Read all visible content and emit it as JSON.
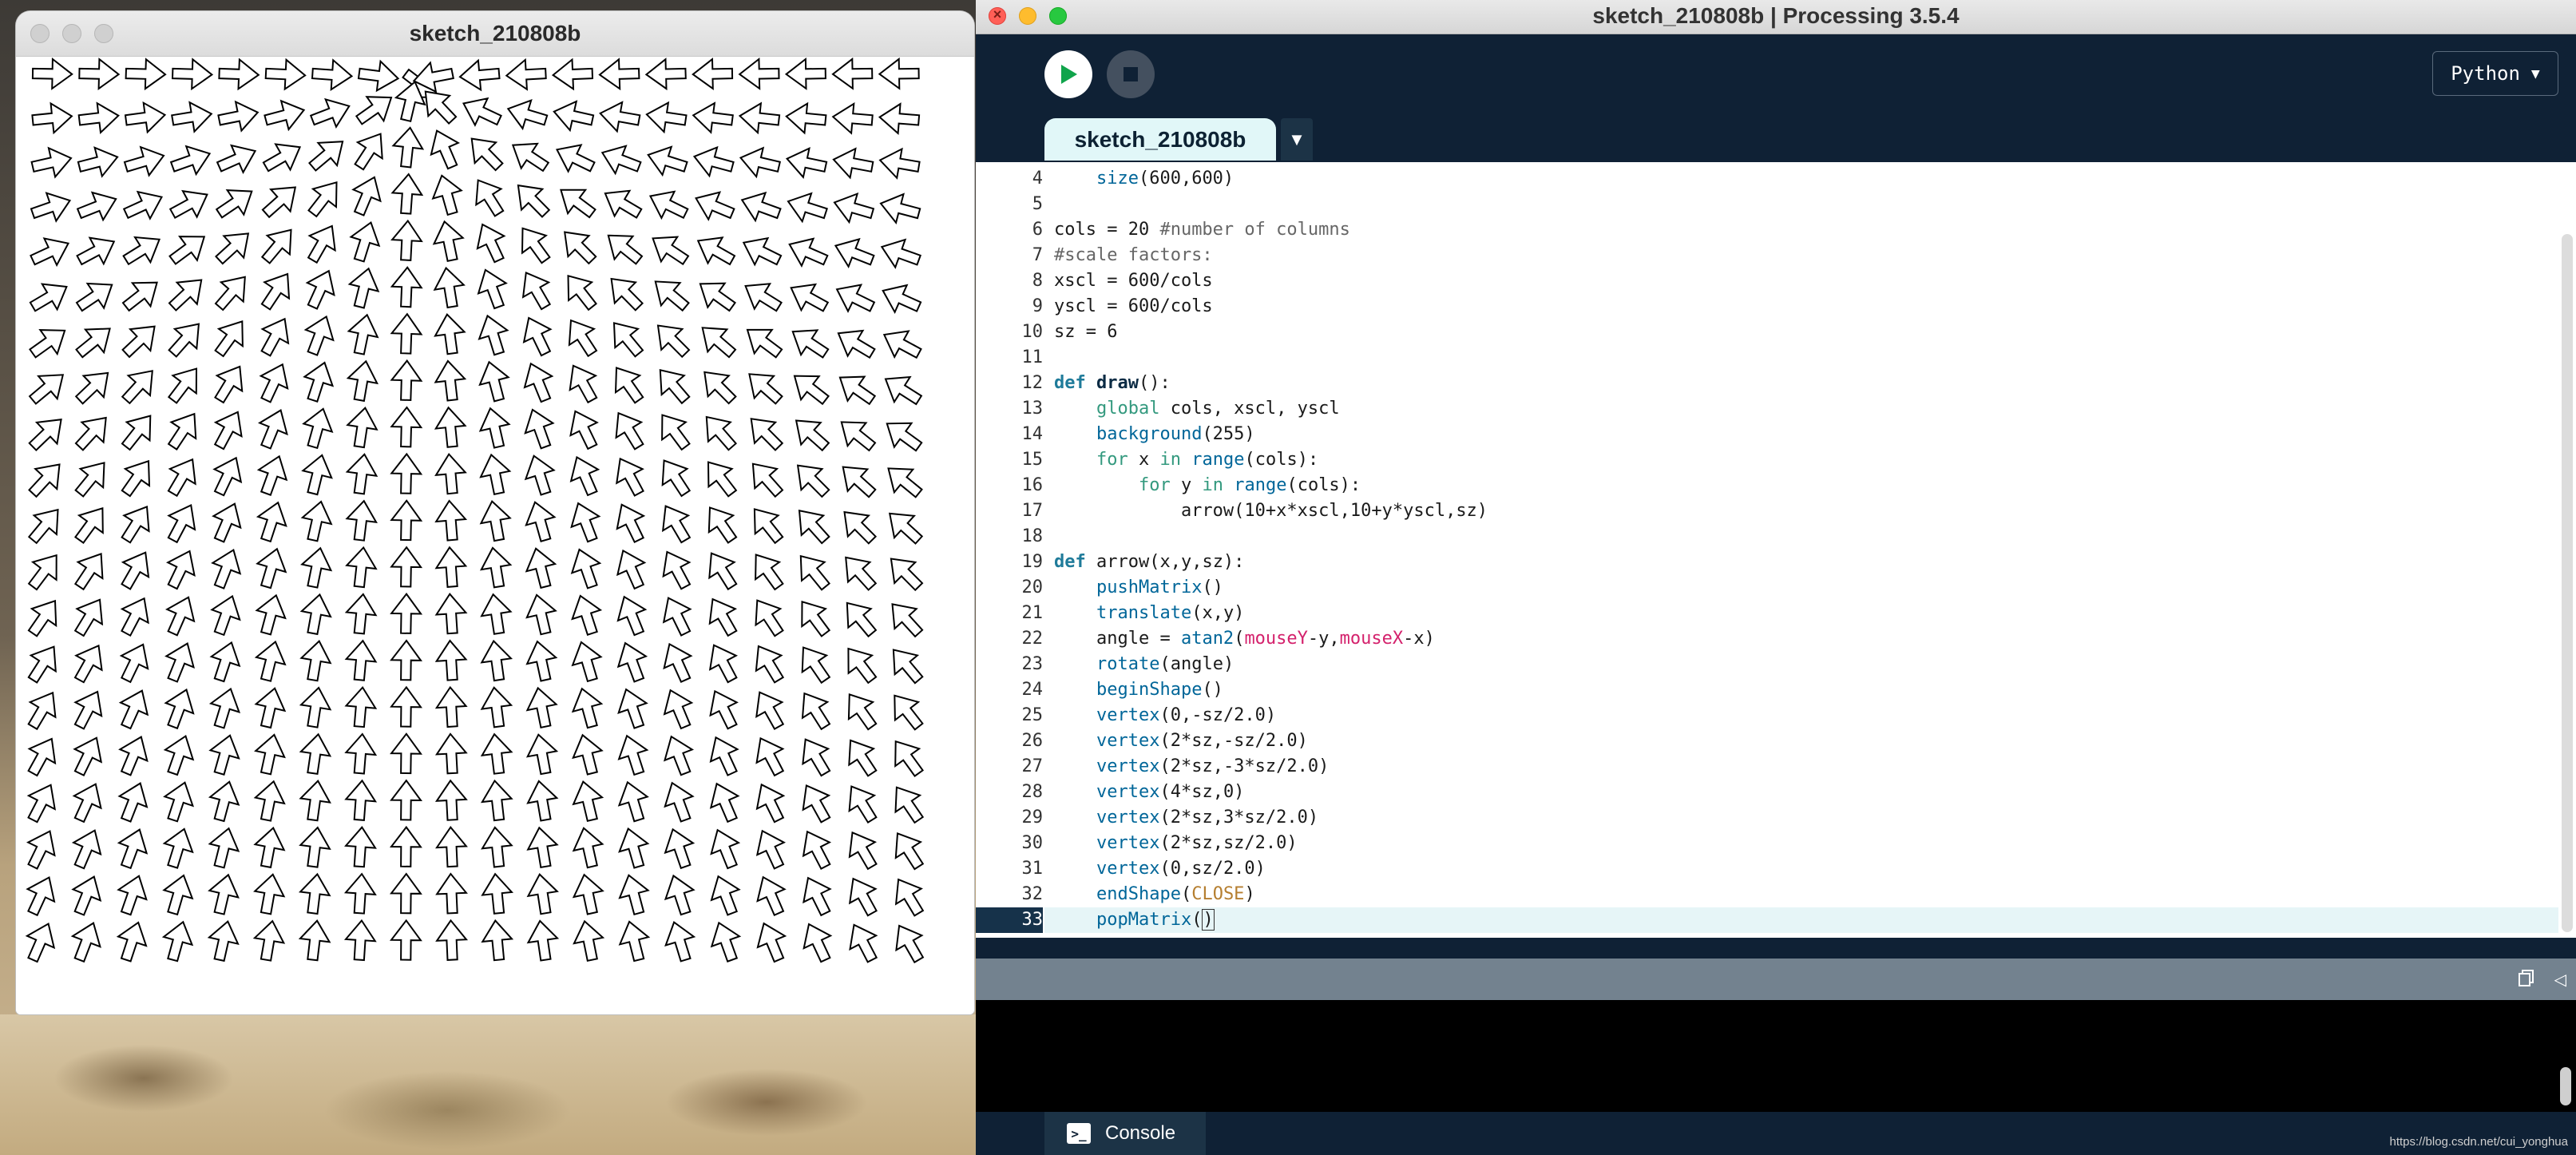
{
  "sketch_window": {
    "title": "sketch_210808b",
    "canvas": {
      "cols": 20,
      "rows": 20,
      "mouse_hint": "mouse near top center of canvas"
    }
  },
  "ide": {
    "window_title": "sketch_210808b | Processing 3.5.4",
    "toolbar": {
      "run_icon": "play-icon",
      "stop_icon": "stop-icon",
      "mode_label": "Python"
    },
    "tab": {
      "label": "sketch_210808b"
    },
    "code_lines": [
      {
        "n": "4",
        "text": "    size(600,600)"
      },
      {
        "n": "5",
        "text": ""
      },
      {
        "n": "6",
        "text": "cols = 20 #number of columns"
      },
      {
        "n": "7",
        "text": "#scale factors:"
      },
      {
        "n": "8",
        "text": "xscl = 600/cols"
      },
      {
        "n": "9",
        "text": "yscl = 600/cols"
      },
      {
        "n": "10",
        "text": "sz = 6"
      },
      {
        "n": "11",
        "text": ""
      },
      {
        "n": "12",
        "text": "def draw():"
      },
      {
        "n": "13",
        "text": "    global cols, xscl, yscl"
      },
      {
        "n": "14",
        "text": "    background(255)"
      },
      {
        "n": "15",
        "text": "    for x in range(cols):"
      },
      {
        "n": "16",
        "text": "        for y in range(cols):"
      },
      {
        "n": "17",
        "text": "            arrow(10+x*xscl,10+y*yscl,sz)"
      },
      {
        "n": "18",
        "text": ""
      },
      {
        "n": "19",
        "text": "def arrow(x,y,sz):"
      },
      {
        "n": "20",
        "text": "    pushMatrix()"
      },
      {
        "n": "21",
        "text": "    translate(x,y)"
      },
      {
        "n": "22",
        "text": "    angle = atan2(mouseY-y,mouseX-x)"
      },
      {
        "n": "23",
        "text": "    rotate(angle)"
      },
      {
        "n": "24",
        "text": "    beginShape()"
      },
      {
        "n": "25",
        "text": "    vertex(0,-sz/2.0)"
      },
      {
        "n": "26",
        "text": "    vertex(2*sz,-sz/2.0)"
      },
      {
        "n": "27",
        "text": "    vertex(2*sz,-3*sz/2.0)"
      },
      {
        "n": "28",
        "text": "    vertex(4*sz,0)"
      },
      {
        "n": "29",
        "text": "    vertex(2*sz,3*sz/2.0)"
      },
      {
        "n": "30",
        "text": "    vertex(2*sz,sz/2.0)"
      },
      {
        "n": "31",
        "text": "    vertex(0,sz/2.0)"
      },
      {
        "n": "32",
        "text": "    endShape(CLOSE)"
      },
      {
        "n": "33",
        "text": "    popMatrix()"
      }
    ],
    "current_line": "33",
    "console": {
      "tab_label": "Console",
      "output": ""
    },
    "watermark": "https://blog.csdn.net/cui_yonghua"
  }
}
